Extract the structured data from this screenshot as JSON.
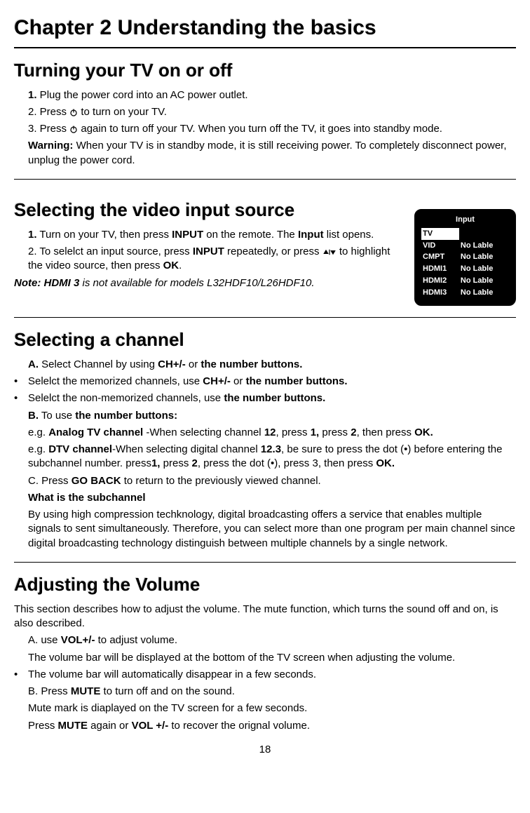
{
  "chapter": "Chapter 2 Understanding the basics",
  "page_number": "18",
  "s1": {
    "heading": "Turning your TV on or off",
    "step1_num": "1.",
    "step1_text": " Plug the power cord into an AC power outlet.",
    "step2_a": "2. Press ",
    "step2_b": " to turn on your TV.",
    "step3_a": "3. Press ",
    "step3_b": " again to turn off your TV. When you turn off the TV, it goes into standby mode.",
    "warning_label": "Warning:",
    "warning_text": " When your TV is in standby mode, it is still receiving power. To completely disconnect power, unplug the power cord."
  },
  "s2": {
    "heading": "Selecting the video input source",
    "step1_num": "1.",
    "step1_a": " Turn on your TV, then press ",
    "step1_input": "INPUT",
    "step1_b": " on the remote. The ",
    "step1_inputword": "Input",
    "step1_c": " list opens.",
    "step2_a": "2. To selelct an input source, press ",
    "step2_input": "INPUT",
    "step2_b": " repeatedly, or press ",
    "step2_c": " to highlight the video source, then press ",
    "step2_ok": "OK",
    "step2_d": ".",
    "note_label": "Note: HDMI 3",
    "note_body": " is not available for models L32HDF10/L26HDF10.",
    "menu": {
      "title": "Input",
      "rows": [
        {
          "k": "TV",
          "v": ""
        },
        {
          "k": "VID",
          "v": "No Lable"
        },
        {
          "k": "CMPT",
          "v": "No Lable"
        },
        {
          "k": "HDMI1",
          "v": "No Lable"
        },
        {
          "k": "HDMI2",
          "v": "No Lable"
        },
        {
          "k": "HDMI3",
          "v": "No Lable"
        }
      ]
    }
  },
  "s3": {
    "heading": "Selecting a channel",
    "a_label": "A.",
    "a_1": " Select Channel by using ",
    "a_ch": "CH+/-",
    "a_2": " or ",
    "a_nb": "the number buttons.",
    "b1_1": "Selelct the memorized channels, use ",
    "b1_ch": "CH+/-",
    "b1_2": " or ",
    "b1_nb": "the number buttons.",
    "b2_1": "Selelct the non-memorized channels, use ",
    "b2_nb": "the number buttons.",
    "b_label": "B.",
    "b_text1": " To use ",
    "b_text2": "the number buttons:",
    "eg1_a": "e.g. ",
    "eg1_atv": "Analog TV channel",
    "eg1_b": " -When selecting channel ",
    "eg1_12": "12",
    "eg1_c": ", press ",
    "eg1_1": "1,",
    "eg1_d": " press ",
    "eg1_2": "2",
    "eg1_e": ", then press ",
    "eg1_ok": "OK.",
    "eg2_a": "e.g. ",
    "eg2_dtv": "DTV channel",
    "eg2_b": "-When selecting digital channel ",
    "eg2_123": "12.3",
    "eg2_c": ", be sure to press the dot (•) before entering the subchannel number. press",
    "eg2_1": "1,",
    "eg2_d": " press ",
    "eg2_2": "2",
    "eg2_e": ", press the dot (•), press 3, then press ",
    "eg2_ok": "OK.",
    "c_1": "C. Press ",
    "c_goback": "GO BACK",
    "c_2": " to return to the previously viewed channel.",
    "sub_hdr": "What is the subchannel",
    "sub_body": "By using high compression techknology, digital broadcasting offers a service that enables multiple signals to sent simultaneously. Therefore, you can select more than one program per main channel since digital broadcasting technology distinguish between multiple channels by a single network."
  },
  "s4": {
    "heading": "Adjusting the Volume",
    "intro": "This section describes how to adjust the volume. The mute function, which turns the sound off and on, is also described.",
    "a_1": "A. use ",
    "a_vol": "VOL+/-",
    "a_2": " to adjust volume.",
    "a_line2": "The volume bar will be displayed at the bottom of the TV screen when adjusting the volume.",
    "bullet": "The volume bar will automatically disappear in a few seconds.",
    "b_1": "B. Press ",
    "b_mute": "MUTE",
    "b_2": " to turn off and on the sound.",
    "b_line2": "Mute mark is diaplayed on the TV screen for a few seconds.",
    "b_3a": "Press ",
    "b_mute2": "MUTE",
    "b_3b": " again or ",
    "b_vol": "VOL +/-",
    "b_3c": " to recover the orignal volume."
  }
}
